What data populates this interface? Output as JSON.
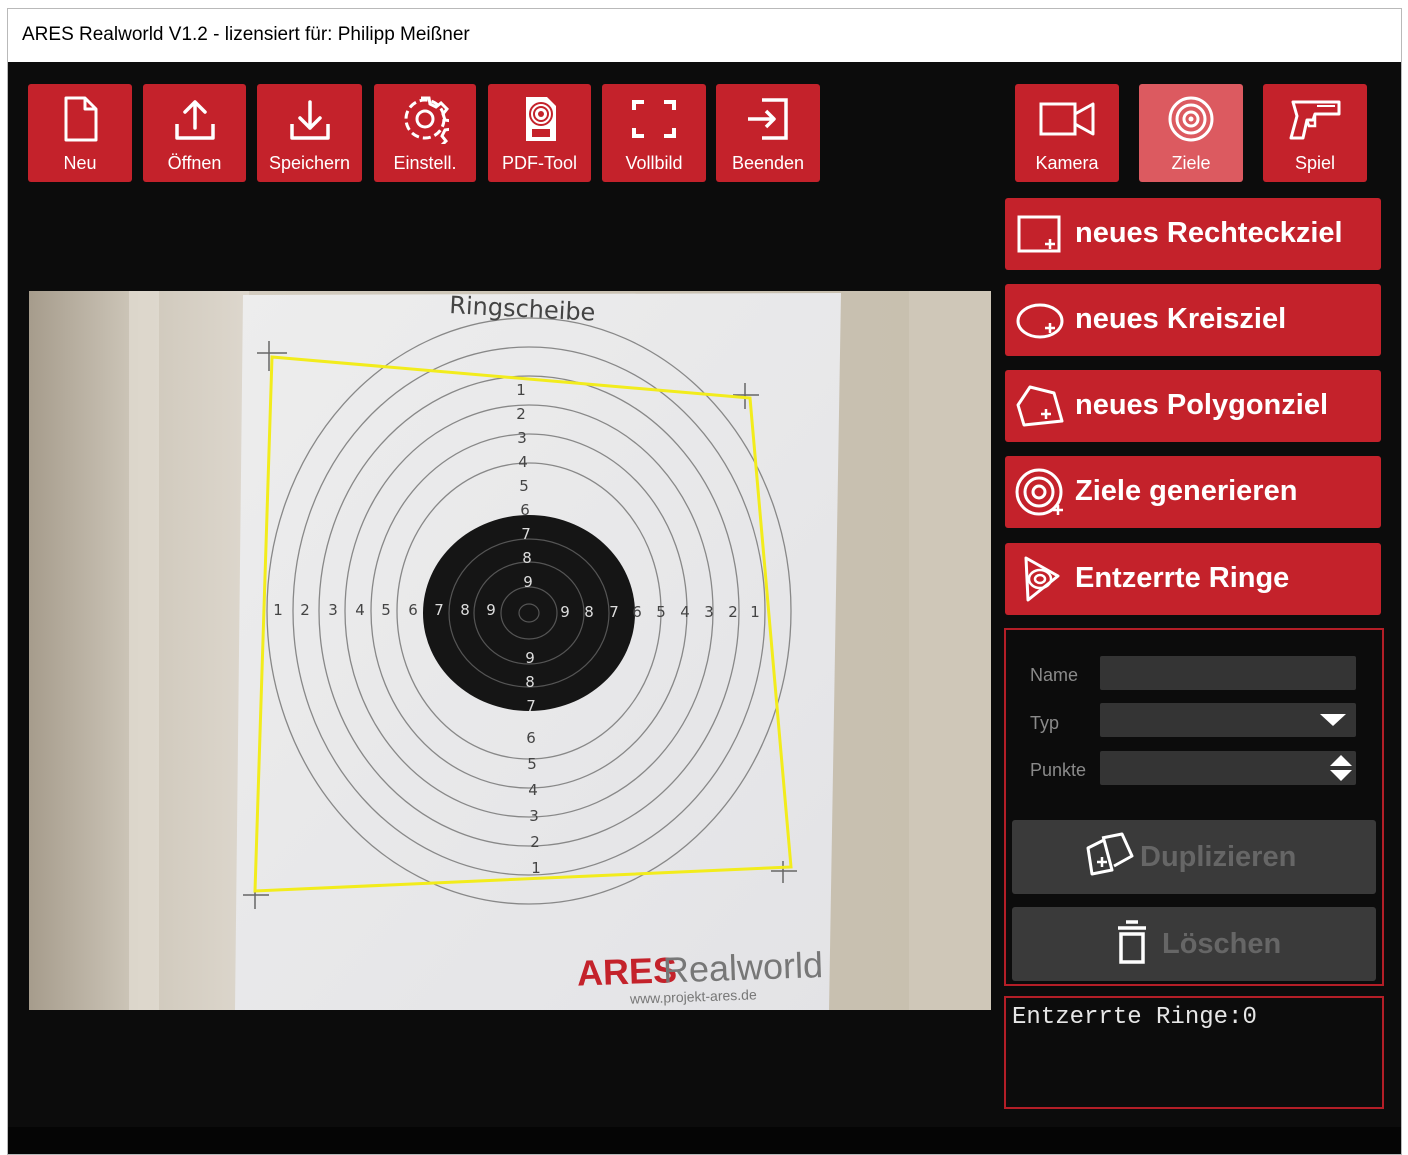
{
  "window": {
    "title": "ARES Realworld V1.2 - lizensiert für: Philipp Meißner",
    "accent_color": "#c4222b",
    "active_color": "#dc5a60",
    "background": "#0c0c0c"
  },
  "toolbar": {
    "items": [
      {
        "label": "Neu",
        "icon": "new-file-icon"
      },
      {
        "label": "Öffnen",
        "icon": "upload-icon"
      },
      {
        "label": "Speichern",
        "icon": "download-icon"
      },
      {
        "label": "Einstell.",
        "icon": "gear-icon"
      },
      {
        "label": "PDF-Tool",
        "icon": "pdf-icon"
      },
      {
        "label": "Vollbild",
        "icon": "fullscreen-icon"
      },
      {
        "label": "Beenden",
        "icon": "exit-icon"
      }
    ]
  },
  "mode_toolbar": {
    "items": [
      {
        "label": "Kamera",
        "icon": "camera-icon",
        "active": false
      },
      {
        "label": "Ziele",
        "icon": "target-icon",
        "active": true
      },
      {
        "label": "Spiel",
        "icon": "pistol-icon",
        "active": false
      }
    ]
  },
  "actions": {
    "items": [
      {
        "label": "neues Rechteckziel",
        "icon": "rectangle-add-icon"
      },
      {
        "label": "neues Kreisziel",
        "icon": "circle-add-icon"
      },
      {
        "label": "neues Polygonziel",
        "icon": "polygon-add-icon"
      },
      {
        "label": "Ziele generieren",
        "icon": "target-generate-icon"
      },
      {
        "label": "Entzerrte Ringe",
        "icon": "warped-rings-icon"
      }
    ]
  },
  "camera": {
    "target_title": "Ringscheibe",
    "brand_ares": "ARES",
    "brand_realworld": "Realworld",
    "brand_url": "www.projekt-ares.de",
    "ring_numbers_vertical_top": [
      "1",
      "2",
      "3",
      "4",
      "5",
      "6",
      "7",
      "8",
      "9"
    ],
    "ring_numbers_vertical_bottom": [
      "9",
      "8",
      "7",
      "6",
      "5",
      "4",
      "3",
      "2",
      "1"
    ],
    "ring_numbers_horizontal_left": [
      "1",
      "2",
      "3",
      "4",
      "5",
      "6",
      "7",
      "8",
      "9"
    ],
    "ring_numbers_horizontal_right": [
      "9",
      "8",
      "7",
      "6",
      "5",
      "4",
      "3",
      "2",
      "1"
    ],
    "selection_color": "#f2ec1c"
  },
  "properties": {
    "name_label": "Name",
    "name_value": "",
    "type_label": "Typ",
    "type_value": "",
    "points_label": "Punkte",
    "points_value": "",
    "duplicate_label": "Duplizieren",
    "delete_label": "Löschen"
  },
  "status": {
    "text": "Entzerrte Ringe:0"
  }
}
